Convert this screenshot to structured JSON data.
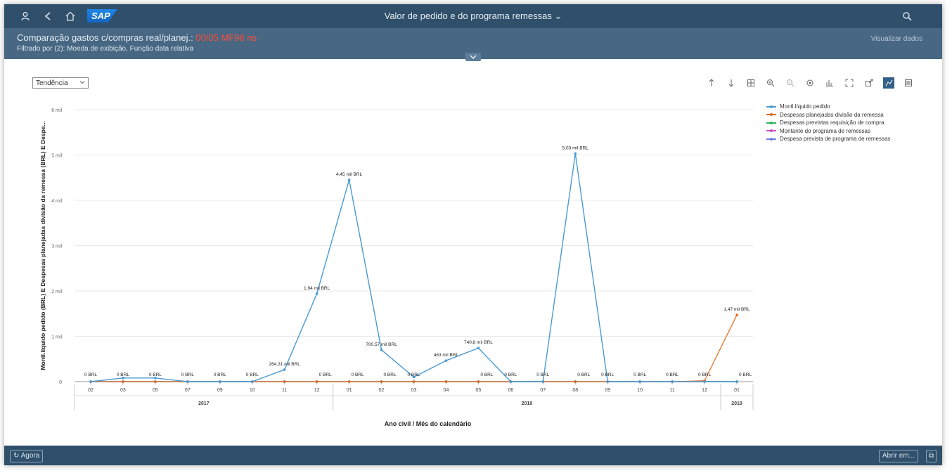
{
  "shell": {
    "title": "Valor de pedido e do programa remessas",
    "title_chevron": "⌄",
    "logo": "SAP"
  },
  "header": {
    "line1_prefix": "Comparação gastos c/compras real/planej.:",
    "line1_value": "00/05 MF96 ns",
    "line2": "Filtrado por (2): Moeda de exibição, Função data relativa",
    "right": "Visualizar dados"
  },
  "controls": {
    "view_select": "Tendência"
  },
  "colors": {
    "shell": "#2f4f6a",
    "header": "#476782",
    "series": [
      "#4a9ad4",
      "#e06b1e",
      "#2bb35c",
      "#c94ec9",
      "#6c7ae0"
    ]
  },
  "chart_data": {
    "type": "line",
    "ylabel": "Montl.líquido pedido (BRL) E Despesas planejadas divisão da remessa (BRL) E Despe...",
    "xlabel": "Ano civil / Mês do calendário",
    "y_ticks": [
      "0",
      "1 mil",
      "2 mil",
      "3 mil",
      "4 mil",
      "5 mil",
      "6 mil"
    ],
    "ylim": [
      0,
      6000
    ],
    "months": [
      "02",
      "03",
      "05",
      "07",
      "09",
      "10",
      "11",
      "12",
      "01",
      "02",
      "03",
      "04",
      "05",
      "06",
      "07",
      "08",
      "09",
      "10",
      "11",
      "12",
      "01"
    ],
    "years": [
      {
        "label": "2017",
        "start": 0,
        "end": 7
      },
      {
        "label": "2018",
        "start": 8,
        "end": 19
      },
      {
        "label": "2019",
        "start": 20,
        "end": 20
      }
    ],
    "series": [
      {
        "name": "Montl.líquido pedido",
        "values": [
          0,
          80,
          80,
          0,
          0,
          0,
          264.31,
          1940,
          4450,
          700.57,
          100,
          463,
          740.8,
          0,
          0,
          5030,
          0,
          0,
          0,
          0,
          0
        ]
      },
      {
        "name": "Despesas planejadas divisão da remessa",
        "values": [
          0,
          0,
          0,
          0,
          0,
          0,
          0,
          0,
          0,
          0,
          0,
          0,
          0,
          0,
          0,
          0,
          0,
          0,
          0,
          20,
          1470
        ]
      },
      {
        "name": "Despesas previstas requisição de compra",
        "values": [
          0,
          0,
          0,
          0,
          0,
          0,
          0,
          0,
          0,
          0,
          0,
          0,
          0,
          0,
          0,
          0,
          0,
          0,
          0,
          0,
          0
        ]
      },
      {
        "name": "Montante do programa de remessas",
        "values": [
          0,
          0,
          0,
          0,
          0,
          0,
          0,
          0,
          0,
          0,
          0,
          0,
          0,
          0,
          0,
          0,
          0,
          0,
          0,
          0,
          0
        ]
      },
      {
        "name": "Despesa prevista de programa de remessas",
        "values": [
          0,
          0,
          0,
          0,
          0,
          0,
          0,
          0,
          0,
          0,
          0,
          0,
          0,
          0,
          0,
          0,
          0,
          0,
          0,
          0,
          0
        ]
      }
    ],
    "data_labels": [
      {
        "i": 0,
        "text": "0 BRL"
      },
      {
        "i": 1,
        "text": "0 BRL"
      },
      {
        "i": 2,
        "text": "0 BRL"
      },
      {
        "i": 3,
        "text": "0 BRL"
      },
      {
        "i": 4,
        "text": "0 BRL"
      },
      {
        "i": 5,
        "text": "0 BRL"
      },
      {
        "i": 6,
        "text": "264,31 mil BRL",
        "v": 264.31
      },
      {
        "i": 7,
        "text": "1,94 mil BRL",
        "v": 1940
      },
      {
        "i": 8,
        "text": "4,45 mil BRL",
        "v": 4450
      },
      {
        "i": 9,
        "text": "700,57 mil BRL",
        "v": 700.57
      },
      {
        "i": 10,
        "text": "0 BRL"
      },
      {
        "i": 11,
        "text": "463 mil BRL",
        "v": 463
      },
      {
        "i": 12,
        "text": "740,8 mil BRL",
        "v": 740.8
      },
      {
        "i": 13,
        "text": "0 BRL"
      },
      {
        "i": 14,
        "text": "0 BRL"
      },
      {
        "i": 15,
        "text": "5,03 mil BRL",
        "v": 5030
      },
      {
        "i": 16,
        "text": "0 BRL"
      },
      {
        "i": 17,
        "text": "0 BRL"
      },
      {
        "i": 18,
        "text": "0 BRL"
      },
      {
        "i": 19,
        "text": "0 BRL"
      },
      {
        "i": 20,
        "text": "1,47 mil BRL",
        "v": 1470
      }
    ],
    "zero_labels_extra": [
      {
        "i": 7,
        "text": "0 BRL"
      },
      {
        "i": 8,
        "text": "0 BRL"
      },
      {
        "i": 9,
        "text": "0 BRL"
      },
      {
        "i": 12,
        "text": "0 BRL"
      },
      {
        "i": 15,
        "text": "0 BRL"
      },
      {
        "i": 20,
        "text": "0 BRL"
      }
    ],
    "legend_position": "top-right"
  },
  "footer": {
    "left_button": "Agora",
    "right_button": "Abrir em..."
  }
}
